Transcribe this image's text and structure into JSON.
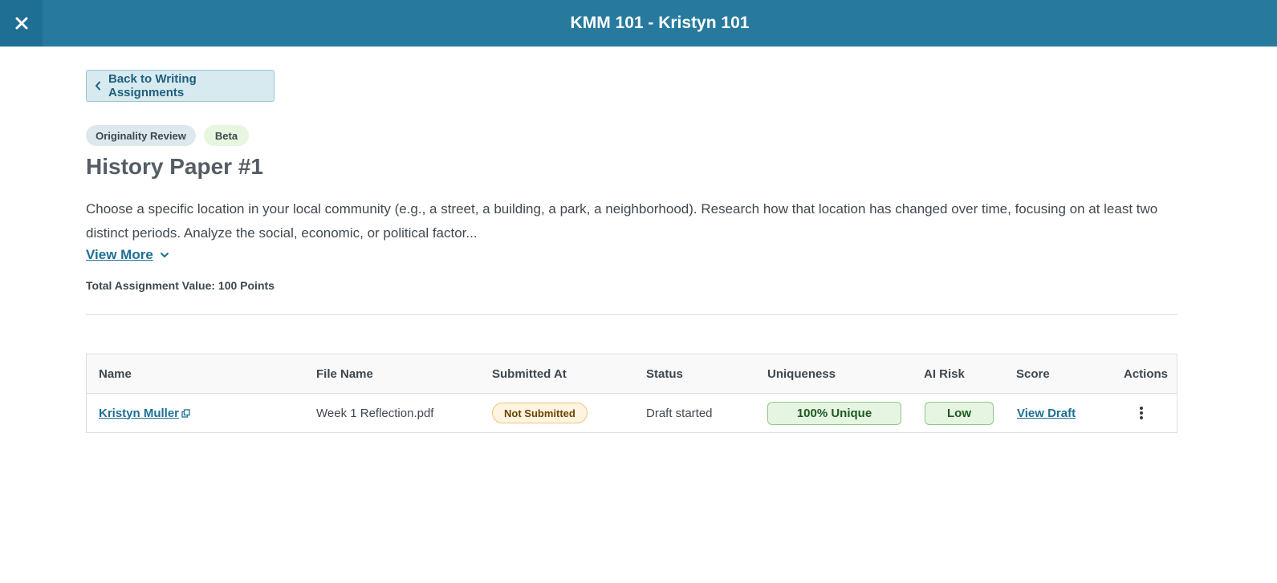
{
  "header": {
    "title": "KMM 101 - Kristyn 101",
    "close_icon": "close-icon"
  },
  "back_button": {
    "label": "Back to Writing Assignments",
    "icon": "chevron-left-icon"
  },
  "badges": [
    {
      "label": "Originality Review"
    },
    {
      "label": "Beta"
    }
  ],
  "assignment": {
    "title": "History Paper #1",
    "description": "Choose a specific location in your local community (e.g., a street, a building, a park, a neighborhood). Research how that location has changed over time, focusing on at least two distinct periods. Analyze the social, economic, or political factor...",
    "view_more_label": "View More",
    "total_value": "Total Assignment Value: 100 Points"
  },
  "table": {
    "columns": [
      "Name",
      "File Name",
      "Submitted At",
      "Status",
      "Uniqueness",
      "AI Risk",
      "Score",
      "Actions"
    ],
    "rows": [
      {
        "name": "Kristyn Muller",
        "file_name": "Week 1 Reflection.pdf",
        "submitted_at": "Not Submitted",
        "status": "Draft started",
        "uniqueness": "100% Unique",
        "ai_risk": "Low",
        "score": "View Draft",
        "actions_icon": "more-vertical-icon"
      }
    ]
  },
  "colors": {
    "header_bg": "#277a9e",
    "link": "#1d6f94",
    "success_bg": "#e6f5e2",
    "warning_bg": "#fff4e0"
  }
}
